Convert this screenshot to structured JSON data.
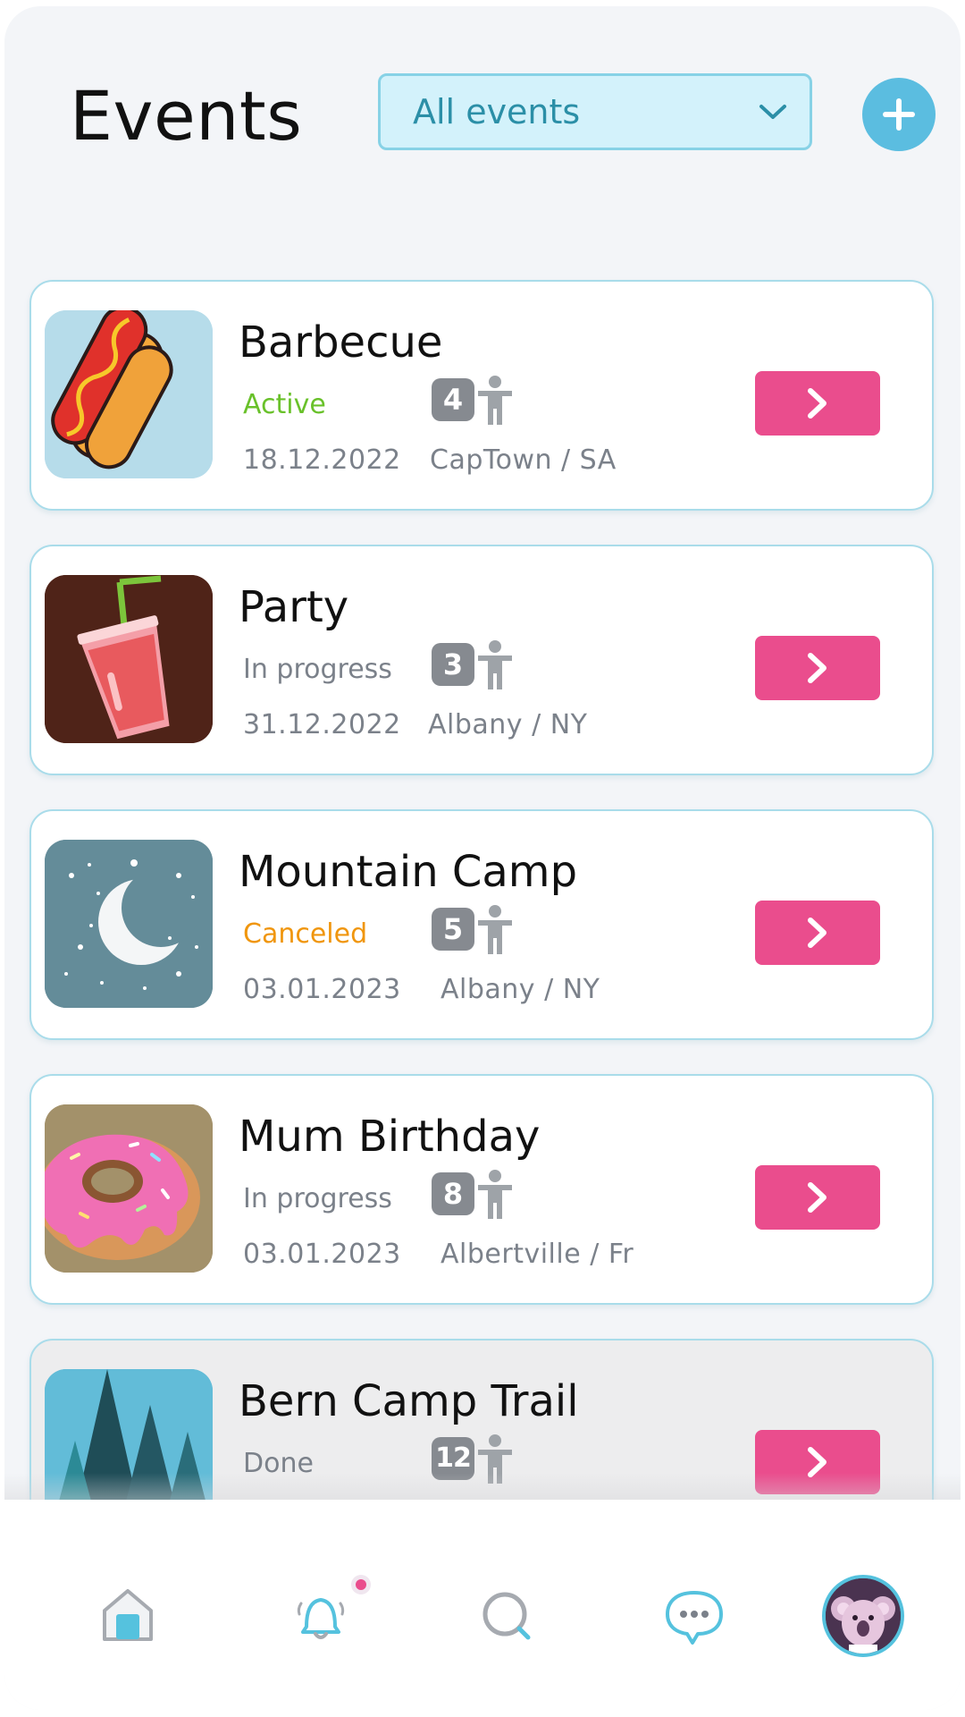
{
  "header": {
    "title": "Events",
    "filter": {
      "selected": "All events"
    },
    "add_button_icon": "plus-icon"
  },
  "events": [
    {
      "title": "Barbecue",
      "status": "Active",
      "count": "4",
      "date": "18.12.2022",
      "location": "CapTown / SA",
      "image": "hotdog-image",
      "status_color": "#69c12a"
    },
    {
      "title": "Party",
      "status": "In progress",
      "count": "3",
      "date": "31.12.2022",
      "location": "Albany / NY",
      "image": "drink-image",
      "status_color": "#7b818a"
    },
    {
      "title": "Mountain Camp",
      "status": "Canceled",
      "count": "5",
      "date": "03.01.2023",
      "location": "Albany / NY",
      "image": "moon-image",
      "status_color": "#f0960e"
    },
    {
      "title": "Mum Birthday",
      "status": "In progress",
      "count": "8",
      "date": "03.01.2023",
      "location": "Albertville / Fr",
      "image": "donut-image",
      "status_color": "#7b818a"
    },
    {
      "title": "Bern Camp Trail",
      "status": "Done",
      "count": "12",
      "image": "forest-image",
      "status_color": "#7b818a"
    }
  ],
  "colors": {
    "accent_pink": "#ea4d8d",
    "accent_blue": "#5bbde0",
    "card_border": "#a9dcea"
  },
  "bottom_nav": {
    "items": [
      "home-icon",
      "bell-icon",
      "search-icon",
      "chat-icon",
      "avatar"
    ],
    "notification_dot": true
  }
}
